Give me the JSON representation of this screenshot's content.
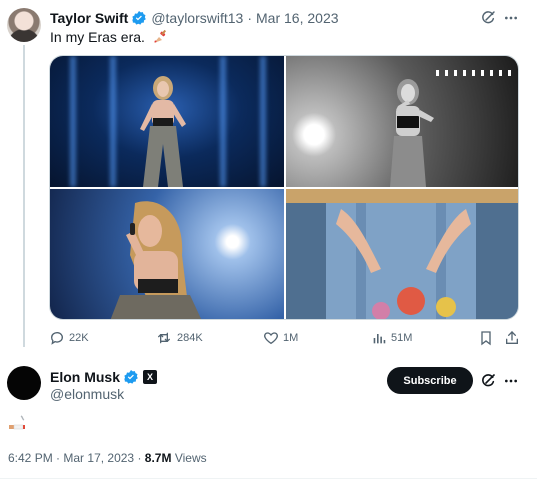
{
  "quoted_tweet": {
    "author_name": "Taylor Swift",
    "author_handle": "@taylorswift13",
    "separator": "·",
    "date": "Mar 16, 2023",
    "text": "In my Eras era.",
    "text_emoji": "painting-nails-emoji",
    "stats": {
      "replies": "22K",
      "reposts": "284K",
      "likes": "1M",
      "views": "51M"
    }
  },
  "main_tweet": {
    "author_name": "Elon Musk",
    "author_handle": "@elonmusk",
    "subscribe_label": "Subscribe",
    "affiliate_badge": "X",
    "reply_emoji": "cigarette-emoji",
    "time": "6:42 PM",
    "separator": "·",
    "date": "Mar 17, 2023",
    "separator2": "·",
    "views_count": "8.7M",
    "views_label": "Views"
  },
  "colors": {
    "verified": "#1d9bf0",
    "text_primary": "#0f1419",
    "text_secondary": "#536471",
    "subscribe_bg": "#0f1419"
  }
}
